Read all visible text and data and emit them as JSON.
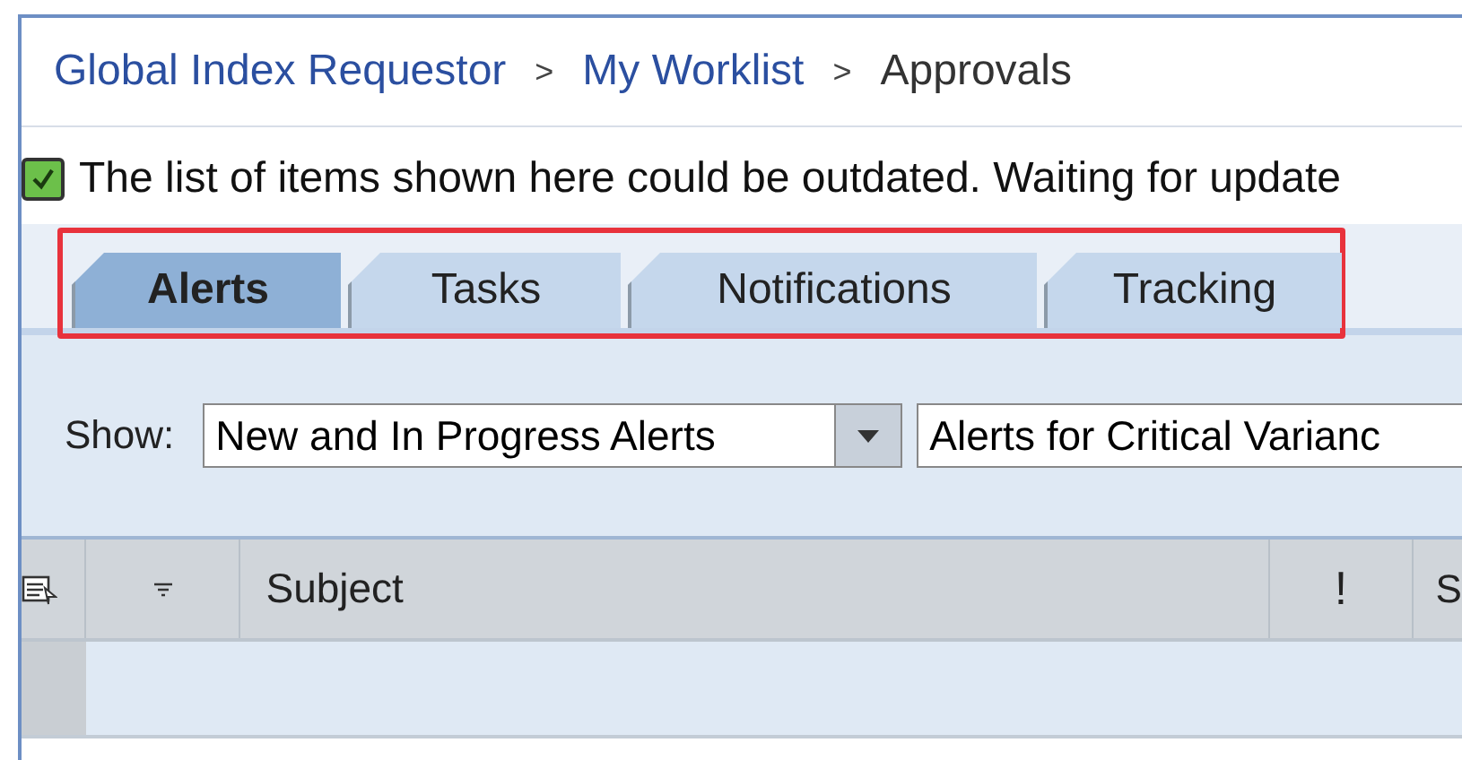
{
  "breadcrumb": [
    {
      "label": "Global Index Requestor",
      "link": true
    },
    {
      "label": "My Worklist",
      "link": true
    },
    {
      "label": "Approvals",
      "link": false
    }
  ],
  "separator": ">",
  "notice": {
    "checked": true,
    "text": "The list of items shown here could be outdated. Waiting for update"
  },
  "tabs": [
    {
      "label": "Alerts",
      "selected": true
    },
    {
      "label": "Tasks",
      "selected": false
    },
    {
      "label": "Notifications",
      "selected": false
    },
    {
      "label": "Tracking",
      "selected": false
    }
  ],
  "show": {
    "label": "Show:",
    "filter": "New and In Progress Alerts",
    "category": "Alerts for Critical Varianc"
  },
  "table": {
    "columns": [
      "Subject",
      "!",
      "S"
    ]
  }
}
